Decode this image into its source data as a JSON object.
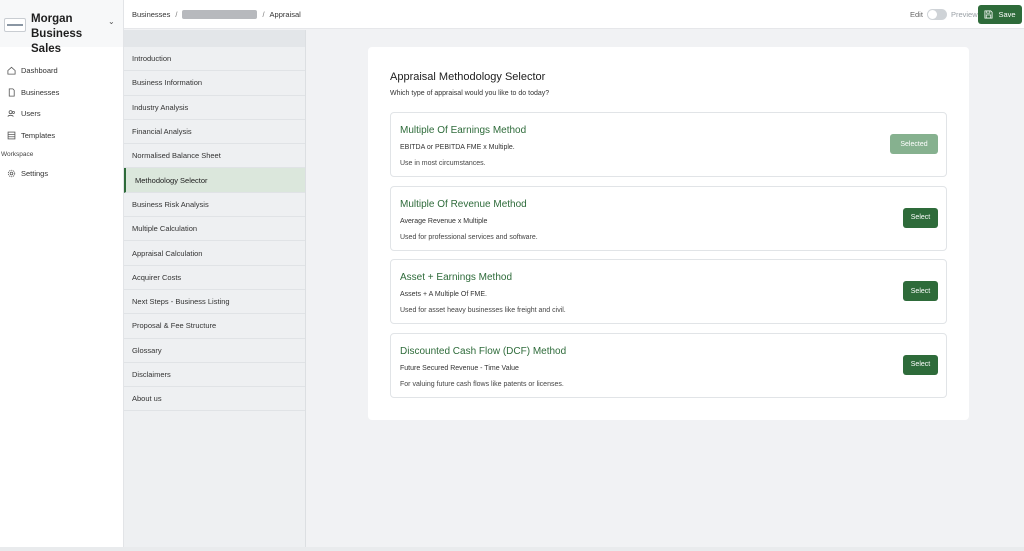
{
  "brand": {
    "name": "Morgan Business Sales"
  },
  "nav": {
    "items": [
      {
        "label": "Dashboard",
        "icon": "home-icon"
      },
      {
        "label": "Businesses",
        "icon": "file-icon"
      },
      {
        "label": "Users",
        "icon": "users-icon"
      },
      {
        "label": "Templates",
        "icon": "templates-icon"
      }
    ],
    "workspace_label": "Workspace",
    "settings_label": "Settings"
  },
  "topbar": {
    "crumb_businesses": "Businesses",
    "crumb_separator": "/",
    "crumb_current": "Appraisal",
    "edit_label": "Edit",
    "preview_label": "Preview",
    "save_label": "Save"
  },
  "sections": [
    "Introduction",
    "Business Information",
    "Industry Analysis",
    "Financial Analysis",
    "Normalised Balance Sheet",
    "Methodology Selector",
    "Business Risk Analysis",
    "Multiple Calculation",
    "Appraisal Calculation",
    "Acquirer Costs",
    "Next Steps - Business Listing",
    "Proposal & Fee Structure",
    "Glossary",
    "Disclaimers",
    "About us"
  ],
  "active_section_index": 5,
  "panel": {
    "title": "Appraisal Methodology Selector",
    "subtitle": "Which type of appraisal would you like to do today?"
  },
  "methods": [
    {
      "title": "Multiple Of Earnings Method",
      "desc": "EBITDA or PEBITDA FME x Multiple.",
      "use": "Use in most circumstances.",
      "button": "Selected"
    },
    {
      "title": "Multiple Of Revenue Method",
      "desc": "Average Revenue x Multiple",
      "use": "Used for professional services and software.",
      "button": "Select"
    },
    {
      "title": "Asset + Earnings Method",
      "desc": "Assets + A Multiple Of FME.",
      "use": "Used for asset heavy businesses like freight and civil.",
      "button": "Select"
    },
    {
      "title": "Discounted Cash Flow (DCF) Method",
      "desc": "Future Secured Revenue - Time Value",
      "use": "For valuing future cash flows like patents or licenses.",
      "button": "Select"
    }
  ],
  "colors": {
    "accent": "#2e6b3a",
    "selected": "#86b18f"
  }
}
